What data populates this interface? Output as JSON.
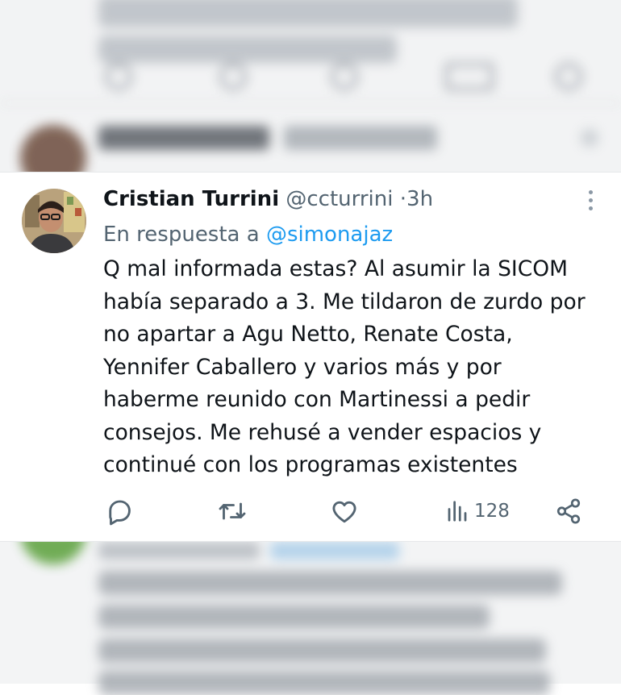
{
  "tweet": {
    "author_name": "Cristian Turrini",
    "author_handle": "@ccturrini",
    "separator": "·",
    "time": "3h",
    "reply_prefix": "En respuesta a",
    "reply_to": "@simonajaz",
    "body_lines": [
      "Q mal informada estas? Al asumir la SICOM",
      "había separado a 3. Me tildaron de zurdo por",
      "no apartar a Agu Netto, Renate Costa,",
      "Yennifer Caballero y varios más y por",
      "haberme reunido con Martinessi a pedir",
      "consejos. Me rehusé a vender espacios y",
      "continué con los programas existentes"
    ],
    "views_count": "128",
    "icons": {
      "reply": "comment-icon",
      "retweet": "retweet-icon",
      "like": "heart-icon",
      "views": "views-icon",
      "share": "share-icon",
      "more": "more-vertical-icon"
    },
    "colors": {
      "link": "#1d9bf0",
      "secondary": "#536471",
      "icon": "#536471"
    }
  }
}
